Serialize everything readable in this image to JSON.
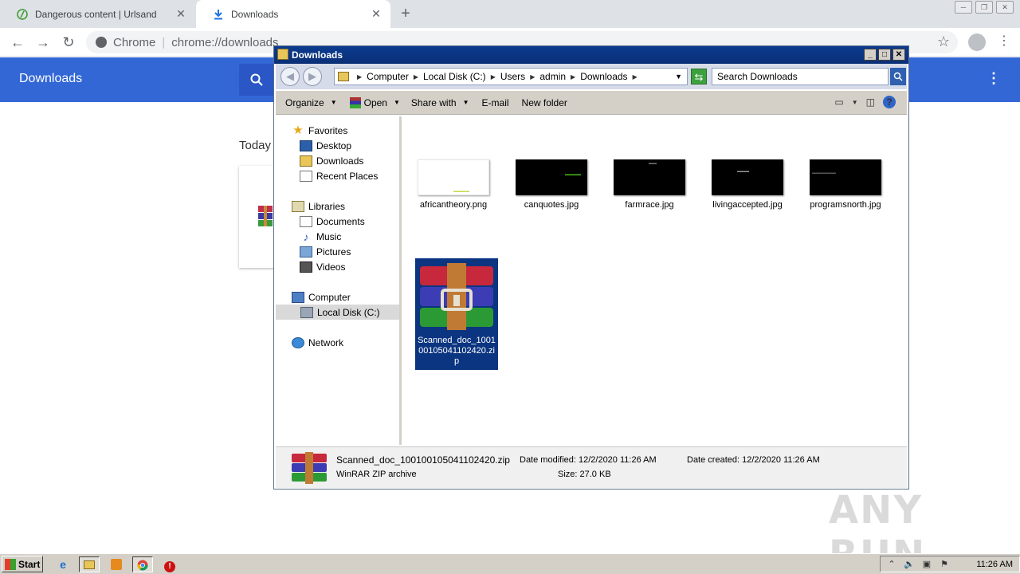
{
  "browser": {
    "tabs": [
      {
        "title": "Dangerous content | Urlsand",
        "active": false
      },
      {
        "title": "Downloads",
        "active": true
      }
    ],
    "new_tab_symbol": "+",
    "omnibox": {
      "scheme": "Chrome",
      "url": "chrome://downloads"
    }
  },
  "downloads_page": {
    "title": "Downloads",
    "section": "Today"
  },
  "explorer": {
    "title": "Downloads",
    "breadcrumbs": [
      "Computer",
      "Local Disk (C:)",
      "Users",
      "admin",
      "Downloads"
    ],
    "search_placeholder": "Search Downloads",
    "commands": {
      "organize": "Organize",
      "open": "Open",
      "share_with": "Share with",
      "email": "E-mail",
      "new_folder": "New folder"
    },
    "nav": {
      "favorites": "Favorites",
      "desktop": "Desktop",
      "downloads": "Downloads",
      "recent_places": "Recent Places",
      "libraries": "Libraries",
      "documents": "Documents",
      "music": "Music",
      "pictures": "Pictures",
      "videos": "Videos",
      "computer": "Computer",
      "local_disk": "Local Disk (C:)",
      "network": "Network"
    },
    "files": [
      {
        "name": "africantheory.png"
      },
      {
        "name": "canquotes.jpg"
      },
      {
        "name": "farmrace.jpg"
      },
      {
        "name": "livingaccepted.jpg"
      },
      {
        "name": "programsnorth.jpg"
      },
      {
        "name": "Scanned_doc_100100105041102420.zip",
        "selected": true
      }
    ],
    "details": {
      "name": "Scanned_doc_100100105041102420.zip",
      "type": "WinRAR ZIP archive",
      "date_modified": "Date modified:  12/2/2020 11:26 AM",
      "size": "Size:  27.0 KB",
      "date_created": "Date created:  12/2/2020 11:26 AM"
    }
  },
  "watermark": "ANY RUN",
  "taskbar": {
    "start": "Start",
    "clock": "11:26 AM",
    "icons": [
      "ie-icon",
      "explorer-icon",
      "media-player-icon",
      "chrome-icon",
      "stop-icon"
    ]
  },
  "colors": {
    "chrome_header": "#3367d6",
    "explorer_title": "#0b3b8f",
    "selection": "#0b3580"
  }
}
